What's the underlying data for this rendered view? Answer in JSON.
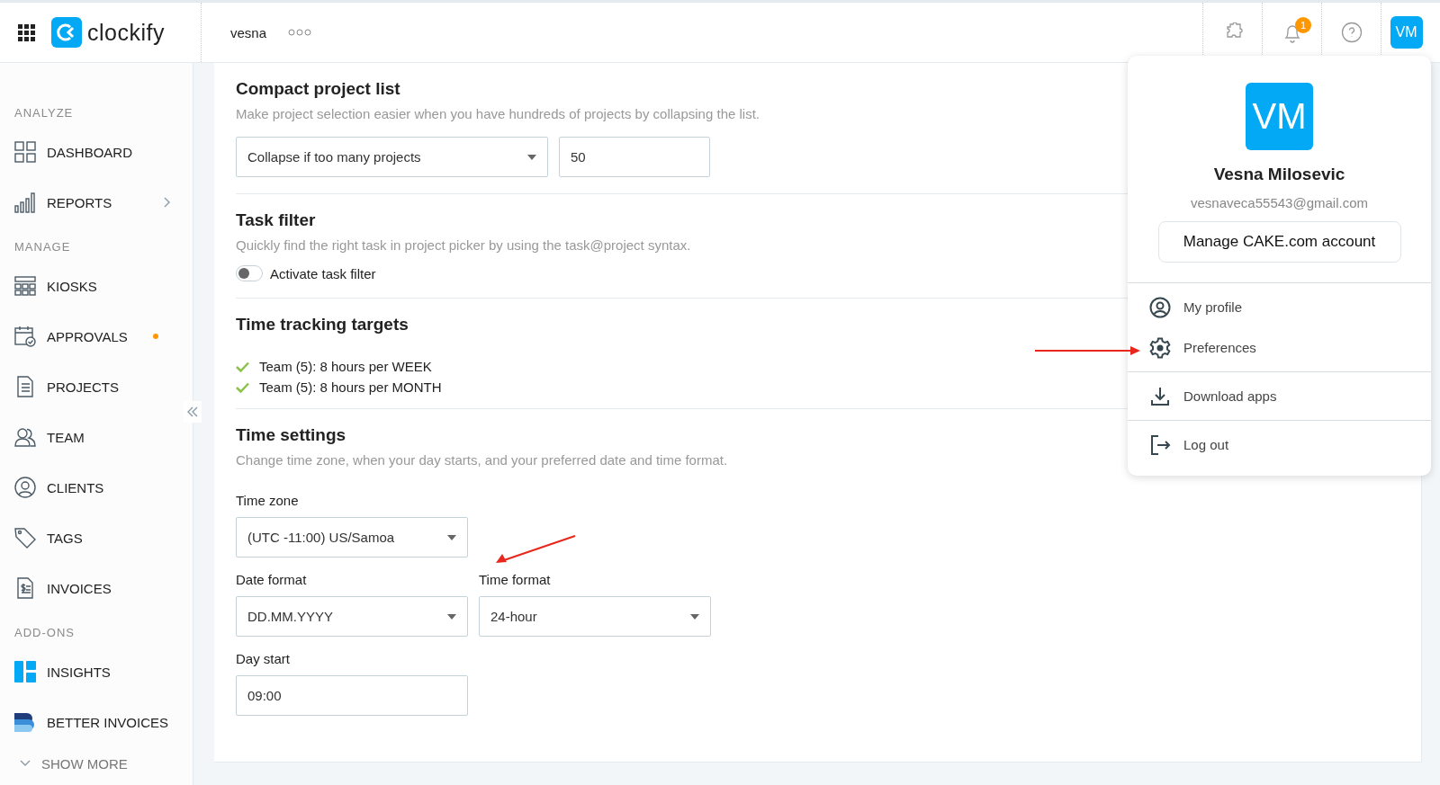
{
  "header": {
    "logo": "clockify",
    "workspace": "vesna",
    "notification_count": "1",
    "avatar_initials": "VM"
  },
  "sidebar": {
    "sections": [
      {
        "title": "ANALYZE",
        "items": [
          {
            "label": "DASHBOARD",
            "kind": "dashboard",
            "expandable": false,
            "has_notification": false
          },
          {
            "label": "REPORTS",
            "kind": "reports",
            "expandable": true,
            "has_notification": false
          }
        ]
      },
      {
        "title": "MANAGE",
        "items": [
          {
            "label": "KIOSKS",
            "kind": "kiosks",
            "expandable": false,
            "has_notification": false
          },
          {
            "label": "APPROVALS",
            "kind": "approvals",
            "expandable": false,
            "has_notification": true
          },
          {
            "label": "PROJECTS",
            "kind": "projects",
            "expandable": false,
            "has_notification": false
          },
          {
            "label": "TEAM",
            "kind": "team",
            "expandable": false,
            "has_notification": false
          },
          {
            "label": "CLIENTS",
            "kind": "clients",
            "expandable": false,
            "has_notification": false
          },
          {
            "label": "TAGS",
            "kind": "tags",
            "expandable": false,
            "has_notification": false
          },
          {
            "label": "INVOICES",
            "kind": "invoices",
            "expandable": false,
            "has_notification": false
          }
        ]
      },
      {
        "title": "ADD-ONS",
        "items": [
          {
            "label": "INSIGHTS",
            "kind": "insights",
            "expandable": false,
            "has_notification": false
          },
          {
            "label": "BETTER INVOICES",
            "kind": "better-invoices",
            "expandable": false,
            "has_notification": false
          }
        ]
      }
    ],
    "show_more": "SHOW MORE"
  },
  "settings": {
    "compact_project_list": {
      "title": "Compact project list",
      "description": "Make project selection easier when you have hundreds of projects by collapsing the list.",
      "mode": "Collapse if too many projects",
      "limit": "50"
    },
    "task_filter": {
      "title": "Task filter",
      "description": "Quickly find the right task in project picker by using the task@project syntax.",
      "toggle_label": "Activate task filter",
      "on": false
    },
    "time_tracking_targets": {
      "title": "Time tracking targets",
      "targets": [
        "Team (5): 8 hours per WEEK",
        "Team (5): 8 hours per MONTH"
      ]
    },
    "time_settings": {
      "title": "Time settings",
      "description": "Change time zone, when your day starts, and your preferred date and time format.",
      "rows": [
        {
          "fields": [
            {
              "label": "Time zone",
              "value": "(UTC -11:00) US/Samoa",
              "kind": "select"
            }
          ]
        },
        {
          "fields": [
            {
              "label": "Date format",
              "value": "DD.MM.YYYY",
              "kind": "select"
            },
            {
              "label": "Time format",
              "value": "24-hour",
              "kind": "select"
            }
          ]
        },
        {
          "fields": [
            {
              "label": "Day start",
              "value": "09:00",
              "kind": "text"
            }
          ]
        }
      ]
    }
  },
  "profile_menu": {
    "avatar_initials": "VM",
    "name": "Vesna Milosevic",
    "email": "vesnaveca55543@gmail.com",
    "manage_button": "Manage CAKE.com account",
    "groups": [
      {
        "items": [
          {
            "label": "My profile",
            "kind": "profile"
          },
          {
            "label": "Preferences",
            "kind": "settings"
          }
        ]
      },
      {
        "items": [
          {
            "label": "Download apps",
            "kind": "download"
          }
        ]
      },
      {
        "items": [
          {
            "label": "Log out",
            "kind": "logout"
          }
        ]
      }
    ]
  }
}
